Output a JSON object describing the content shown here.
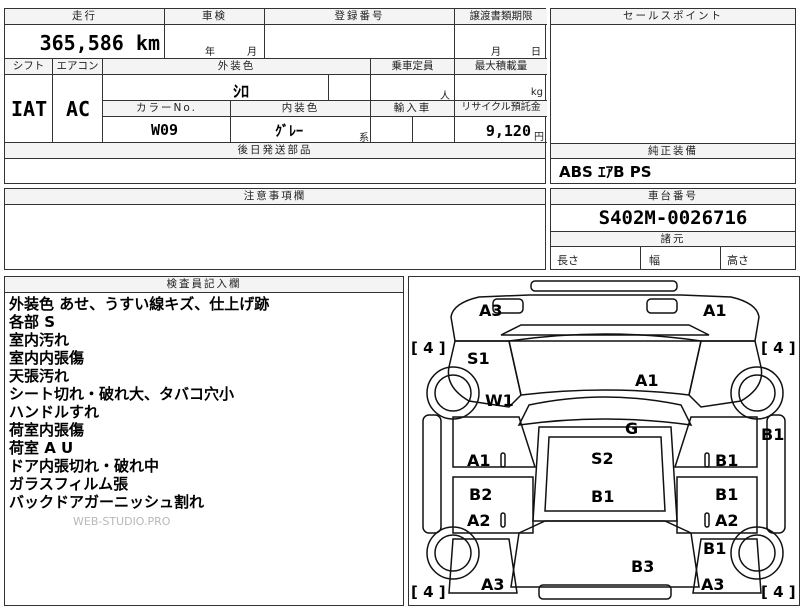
{
  "vehicle": {
    "mileage_label": "走行",
    "mileage_value": "365,586",
    "mileage_unit": "km",
    "inspection_label": "車検",
    "inspection_year": "年",
    "inspection_month": "月",
    "registration_label": "登録番号",
    "transfer_label": "譲渡書類期限",
    "transfer_month": "月",
    "transfer_day": "日",
    "shift_label": "シフト",
    "shift_value": "IAT",
    "ac_label": "エアコン",
    "ac_value": "AC",
    "exterior_label": "外装色",
    "exterior_value": "ｼﾛ",
    "color_no_label": "カラーNo.",
    "color_no_value": "W09",
    "interior_label": "内装色",
    "interior_value": "ｸﾞﾚｰ",
    "interior_suffix": "系",
    "capacity_label": "乗車定員",
    "capacity_unit": "人",
    "load_label": "最大積載量",
    "load_unit": "kg",
    "import_label": "輸入車",
    "recycle_label": "リサイクル預託金",
    "recycle_value": "9,120",
    "recycle_unit": "円",
    "parts_label": "後日発送部品",
    "caution_label": "注意事項欄"
  },
  "right_panel": {
    "sales_point_label": "セールスポイント",
    "equipment_label": "純正装備",
    "equipment_value": "ABS ｴｱB PS",
    "chassis_label": "車台番号",
    "chassis_value": "S402M-0026716",
    "dimensions_label": "諸元",
    "length_label": "長さ",
    "width_label": "幅",
    "height_label": "高さ"
  },
  "inspector": {
    "header": "検査員記入欄",
    "notes": [
      "外装色 あせ、うすい線キズ、仕上げ跡",
      "各部 S",
      "室内汚れ",
      "室内内張傷",
      "天張汚れ",
      "シート切れ・破れ大、タバコ穴小",
      "ハンドルすれ",
      "荷室内張傷",
      "荷室 A U",
      "ドア内張切れ・破れ中",
      "ガラスフィルム張",
      "バックドアガーニッシュ割れ"
    ],
    "watermark": "WEB-STUDIO.PRO"
  },
  "diagram": {
    "marks": {
      "front_left_corner": "A3",
      "front_right_corner": "A1",
      "left_fender": "S1",
      "left_front_tire_area": "W1",
      "hood": "A1",
      "windshield": "G",
      "right_side_panel": "B1",
      "front_left_door": "A1",
      "roof": "S2",
      "front_right_door": "B1",
      "rear_left_door_upper": "B2",
      "rear_left_door_lower": "A2",
      "rear_roof": "B1",
      "rear_right_door_upper": "B1",
      "rear_right_door_lower": "A2",
      "right_rear_fender": "B1",
      "back_door": "B3",
      "rear_left_corner": "A3",
      "rear_right_corner": "A3"
    },
    "tire_tread": {
      "front_left": "4",
      "front_right": "4",
      "rear_left": "4",
      "rear_right": "4"
    }
  }
}
